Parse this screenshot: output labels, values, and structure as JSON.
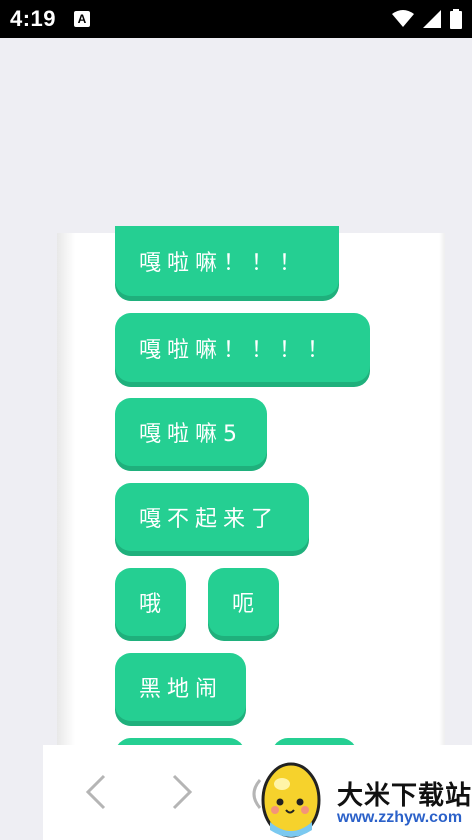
{
  "status_bar": {
    "time": "4:19",
    "notification_badge": "A"
  },
  "buttons": [
    {
      "label": "嘎啦嘛！！！"
    },
    {
      "label": "嘎啦嘛！！！！"
    },
    {
      "label": "嘎啦嘛5"
    },
    {
      "label": "嘎不起来了"
    },
    {
      "label": "哦"
    },
    {
      "label": "呃"
    },
    {
      "label": "黑地闹"
    }
  ],
  "watermark": {
    "brand": "大米下载站",
    "url": "www.zzhyw.com"
  },
  "colors": {
    "chip": "#25cf92",
    "chip_shadow": "#1fb07c",
    "background": "#eeeef3"
  }
}
